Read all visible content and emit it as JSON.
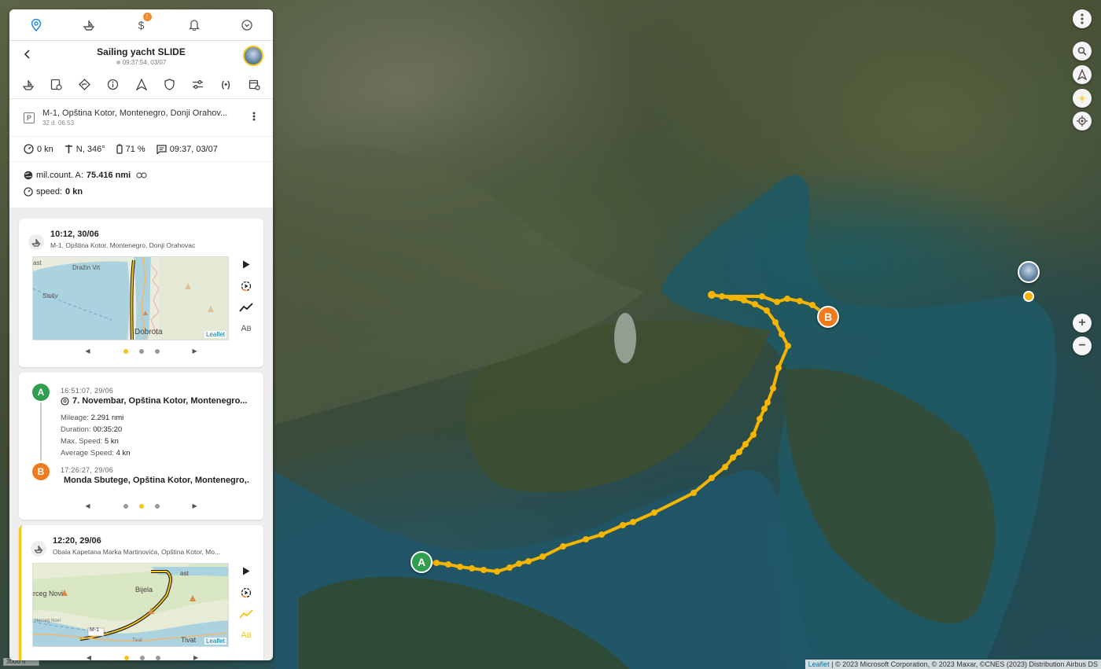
{
  "nav": {
    "billing_badge": "!"
  },
  "header": {
    "title": "Sailing yacht SLIDE",
    "subtitle": "09:37:54, 03/07"
  },
  "location": {
    "address": "M-1, Opština Kotor, Montenegro, Donji Orahov...",
    "duration": "32 d. 06:53"
  },
  "stats": {
    "speed": "0 kn",
    "heading": "N, 346°",
    "battery": "71 %",
    "last_message": "09:37, 03/07"
  },
  "info": {
    "mileage_label": "mil.count. A:",
    "mileage_value": "75.416 nmi",
    "speed_label": "speed:",
    "speed_value": "0 kn"
  },
  "cards": [
    {
      "time": "10:12, 30/06",
      "address": "M-1, Opština Kotor, Montenegro, Donji Orahovac",
      "map_labels": [
        "Dražin Vrt",
        "Stoliv",
        "Dobrota",
        "ast"
      ],
      "leaflet": "Leaflet",
      "active_page": 0
    },
    {
      "a_time": "16:51:07, 29/06",
      "a_address": "7. Novembar, Opština Kotor, Montenegro...",
      "mileage_label": "Mileage:",
      "mileage_value": "2.291 nmi",
      "duration_label": "Duration:",
      "duration_value": "00:35:20",
      "max_speed_label": "Max. Speed:",
      "max_speed_value": "5 kn",
      "avg_speed_label": "Average Speed:",
      "avg_speed_value": "4 kn",
      "b_time": "17:26:27, 29/06",
      "b_address": "Monda Sbutege, Opština Kotor, Montenegro,...",
      "active_page": 1
    },
    {
      "time": "12:20, 29/06",
      "address": "Obala Kapetana Marka Martinovića, Opština Kotor, Mo...",
      "map_labels": [
        "rceg Novi",
        "Bijela",
        "Tivat",
        "M-1",
        "Herceg Novi",
        "Tivat",
        "ast"
      ],
      "leaflet": "Leaflet",
      "active_page": 0
    }
  ],
  "markers": {
    "start": "A",
    "end": "B"
  },
  "map": {
    "scale": "3000 ft",
    "attribution_link": "Leaflet",
    "attribution": "| © 2023 Microsoft Corporation, © 2023 Maxar, ©CNES (2023) Distribution Airbus DS"
  },
  "colors": {
    "accent": "#1e88e5",
    "track": "#f5b400",
    "start": "#2e9e4f",
    "end": "#f07a1e",
    "selected": "#f5c518"
  },
  "icons": [
    "location-pin-icon",
    "boat-icon",
    "dollar-icon",
    "bell-icon",
    "chevron-circle-icon",
    "search-icon",
    "navigation-arrow-icon",
    "sun-icon",
    "gps-icon",
    "plus-icon",
    "minus-icon",
    "more-vertical-icon"
  ]
}
